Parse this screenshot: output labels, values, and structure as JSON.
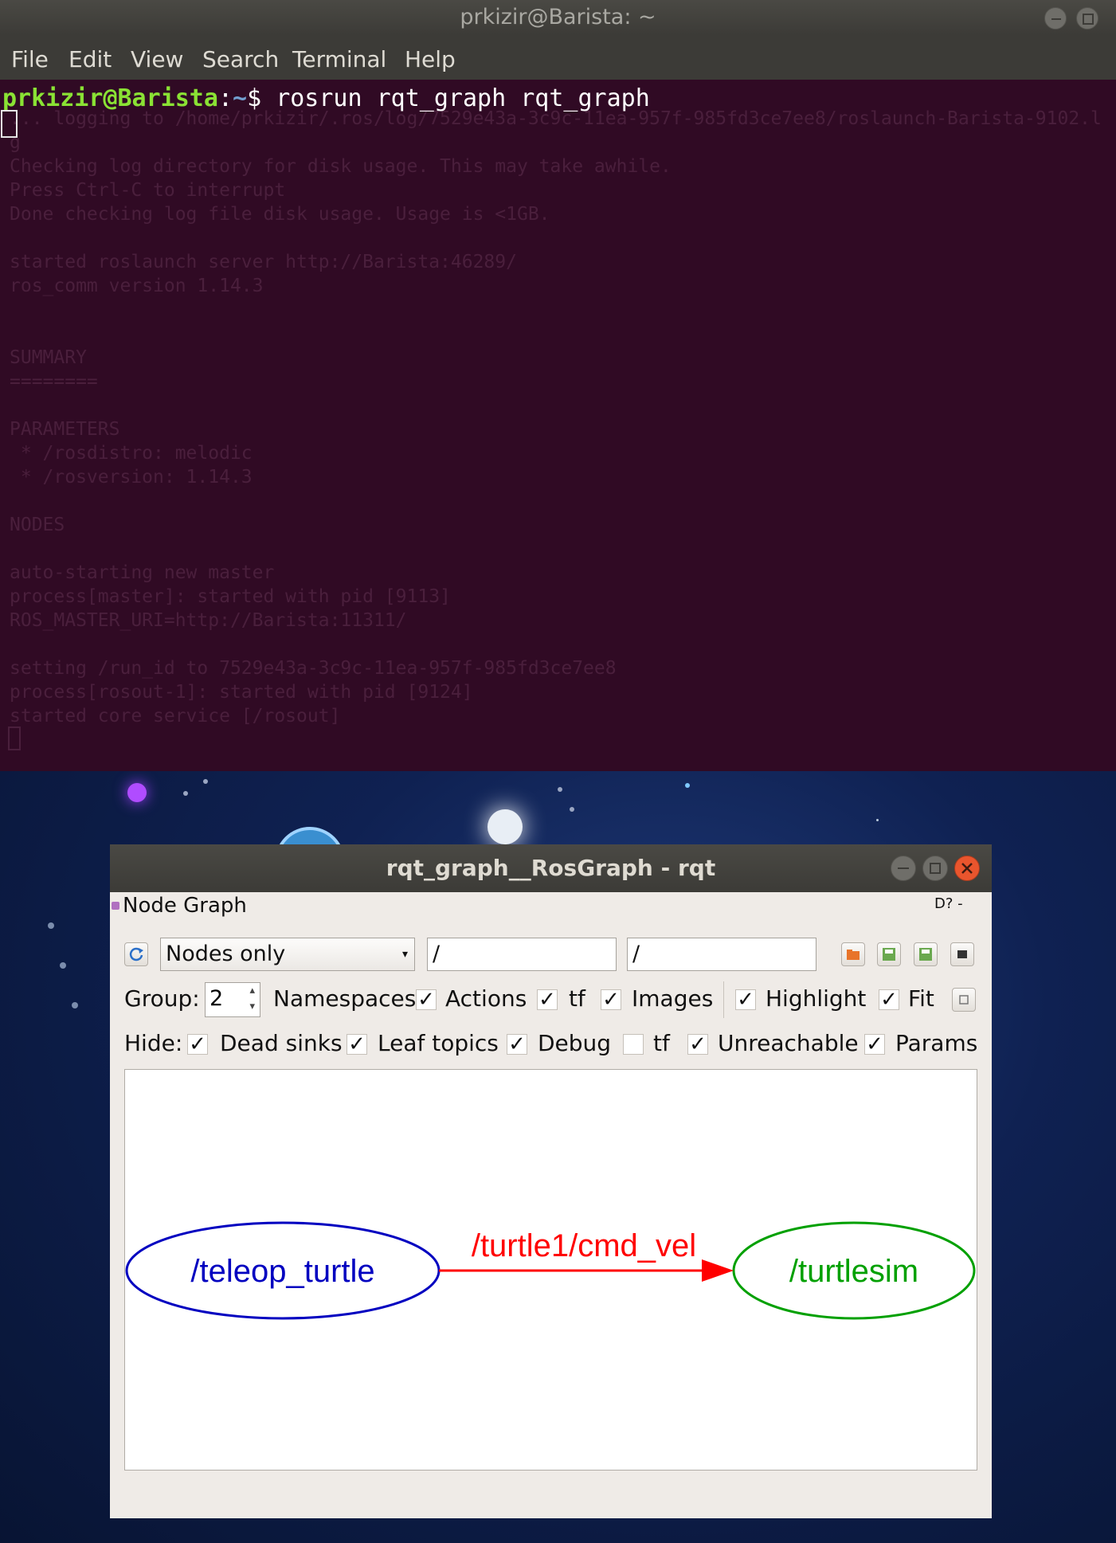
{
  "terminal": {
    "title": "prkizir@Barista: ~",
    "menu": [
      "File",
      "Edit",
      "View",
      "Search",
      "Terminal",
      "Help"
    ],
    "prompt_user": "prkizir@Barista",
    "prompt_sep": ":",
    "prompt_path": "~",
    "prompt_symbol": "$ ",
    "command": "rosrun rqt_graph rqt_graph",
    "faded_log": "... logging to /home/prkizir/.ros/log/7529e43a-3c9c-11ea-957f-985fd3ce7ee8/roslaunch-Barista-9102.l\ng\nChecking log directory for disk usage. This may take awhile.\nPress Ctrl-C to interrupt\nDone checking log file disk usage. Usage is <1GB.\n\nstarted roslaunch server http://Barista:46289/\nros_comm version 1.14.3\n\n\nSUMMARY\n========\n\nPARAMETERS\n * /rosdistro: melodic\n * /rosversion: 1.14.3\n\nNODES\n\nauto-starting new master\nprocess[master]: started with pid [9113]\nROS_MASTER_URI=http://Barista:11311/\n\nsetting /run_id to 7529e43a-3c9c-11ea-957f-985fd3ce7ee8\nprocess[rosout-1]: started with pid [9124]\nstarted core service [/rosout]"
  },
  "rqt": {
    "title": "rqt_graph__RosGraph - rqt",
    "plugin_title": "Node Graph",
    "plugin_controls": "D? -",
    "view_mode": "Nodes only",
    "node_filter": "/",
    "topic_filter": "/",
    "group_label": "Group:",
    "group_value": "2",
    "row1": [
      {
        "label": "Namespaces",
        "checked": true
      },
      {
        "label": "Actions",
        "checked": true
      },
      {
        "label": "tf",
        "checked": true
      },
      {
        "label": "Images",
        "checked": false
      },
      {
        "label": "Highlight",
        "checked": true
      },
      {
        "label": "Fit",
        "checked": true
      }
    ],
    "hide_label": "Hide:",
    "row2": [
      {
        "label": "Dead sinks",
        "checked": true
      },
      {
        "label": "Leaf topics",
        "checked": true
      },
      {
        "label": "Debug",
        "checked": true
      },
      {
        "label": "tf",
        "checked": false
      },
      {
        "label": "Unreachable",
        "checked": true
      },
      {
        "label": "Params",
        "checked": true
      }
    ],
    "check_mark": "✓",
    "graph": {
      "source_node": "/teleop_turtle",
      "target_node": "/turtlesim",
      "edge_label": "/turtle1/cmd_vel",
      "source_color": "#0000c0",
      "target_color": "#00a000",
      "edge_color": "#ff0000"
    }
  },
  "icons": {
    "refresh": "refresh-icon",
    "load": "open-folder-icon",
    "save_dot": "save-dot-icon",
    "save_image": "save-image-icon",
    "screenshot": "screenshot-icon",
    "fit": "fit-view-icon"
  }
}
